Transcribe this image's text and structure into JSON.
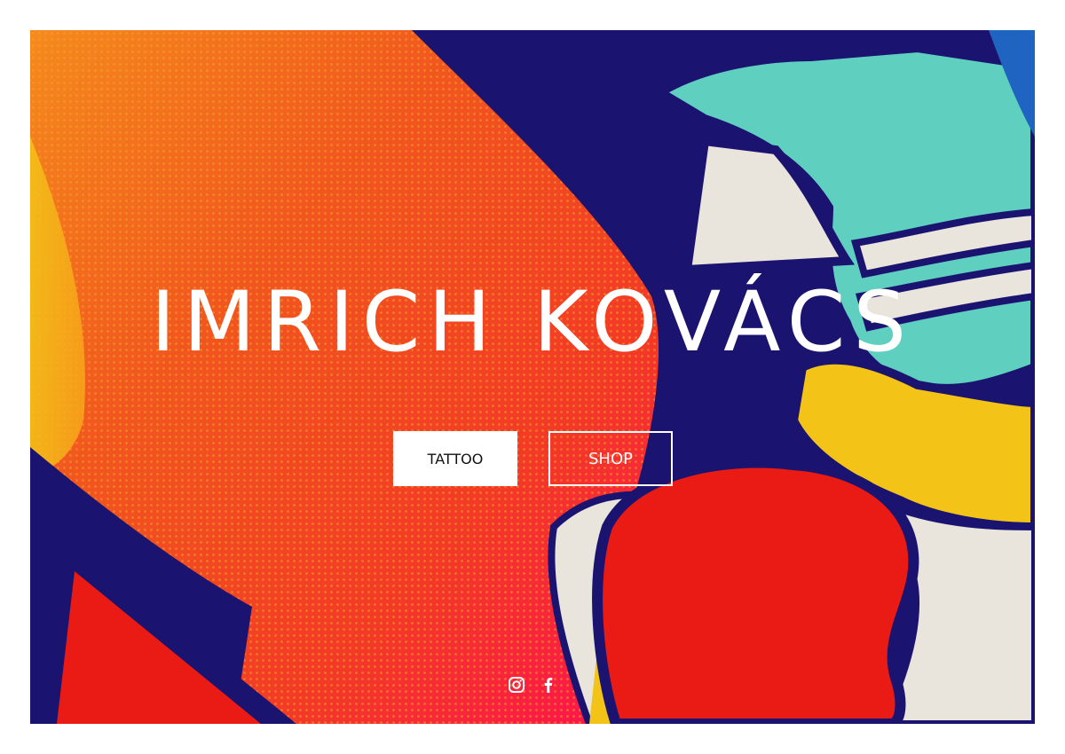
{
  "site": {
    "title": "IMRICH KOVÁCS"
  },
  "nav": {
    "buttons": [
      {
        "label": "TATTOO"
      },
      {
        "label": "SHOP"
      }
    ]
  },
  "social": [
    {
      "icon": "instagram-icon"
    },
    {
      "icon": "facebook-icon"
    }
  ],
  "colors": {
    "navy": "#1a1470",
    "orange": "#f2561f",
    "red": "#ea1a14",
    "pink": "#ff0e52",
    "yellow": "#f3c417",
    "teal": "#5fcfc0",
    "cream": "#e9e4dc",
    "blue": "#1f64c0"
  }
}
